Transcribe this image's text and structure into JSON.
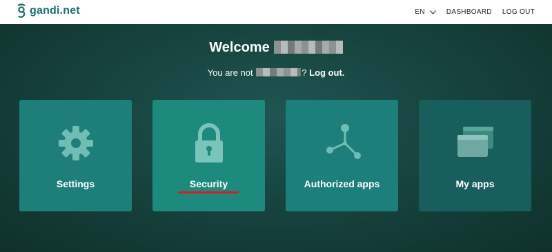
{
  "header": {
    "logo_text": "gandi.net",
    "lang": "EN",
    "dashboard": "DASHBOARD",
    "logout": "LOG OUT"
  },
  "hero": {
    "welcome": "Welcome",
    "not_prefix": "You are not",
    "not_suffix": "?",
    "logout_link": "Log out."
  },
  "cards": [
    {
      "label": "Settings",
      "icon": "gear-icon"
    },
    {
      "label": "Security",
      "icon": "lock-icon"
    },
    {
      "label": "Authorized apps",
      "icon": "nodes-icon"
    },
    {
      "label": "My apps",
      "icon": "windows-icon"
    }
  ],
  "colors": {
    "brand": "#1a6f70",
    "card": "#1d8379",
    "highlight": "#e0191d"
  }
}
